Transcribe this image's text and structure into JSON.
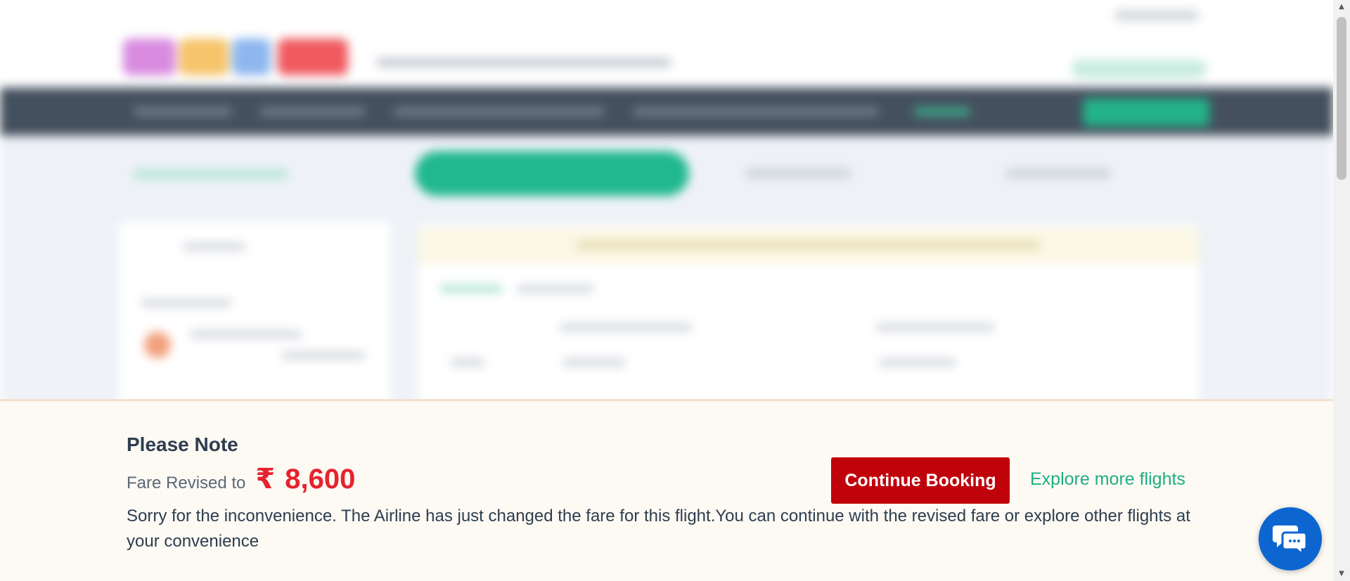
{
  "fare_notice": {
    "title": "Please Note",
    "fare_label": "Fare Revised to",
    "currency_symbol": "₹",
    "fare_value": "8,600",
    "message": "Sorry for the inconvenience. The Airline has just changed the fare for this flight.You can continue with the revised fare or explore other flights at your convenience",
    "continue_label": "Continue Booking",
    "explore_label": "Explore more flights"
  },
  "colors": {
    "accent_red": "#c0020b",
    "fare_red": "#e5232e",
    "link_green": "#1fae83",
    "chat_blue": "#0d66d0",
    "panel_bg": "#fdf9f3"
  },
  "icons": {
    "chat": "chat-bubbles-icon",
    "scroll_up": "triangle-up-icon",
    "scroll_down": "triangle-down-icon"
  }
}
